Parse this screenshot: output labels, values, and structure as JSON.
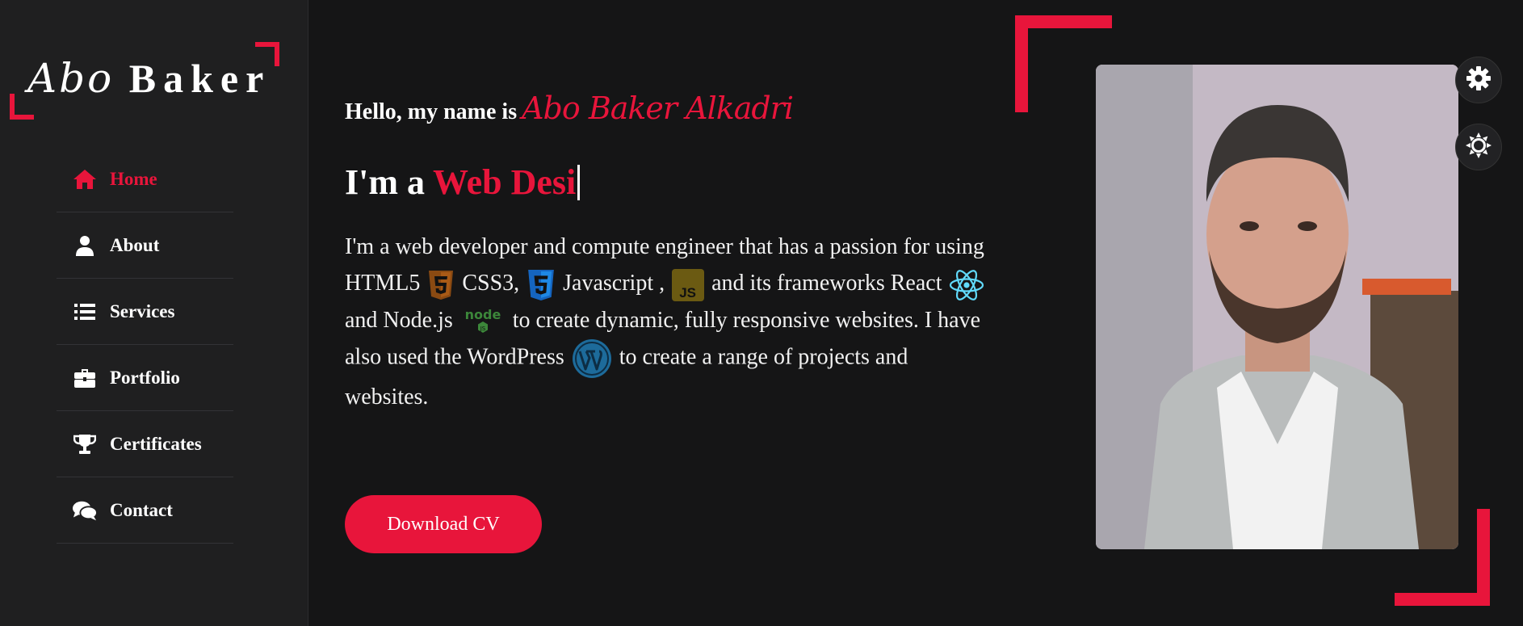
{
  "brand": {
    "script_part": "Abo",
    "bold_part": "Baker",
    "accent_color": "#e8153b"
  },
  "nav": {
    "items": [
      {
        "label": "Home",
        "icon": "home-icon",
        "active": true
      },
      {
        "label": "About",
        "icon": "user-icon",
        "active": false
      },
      {
        "label": "Services",
        "icon": "list-icon",
        "active": false
      },
      {
        "label": "Portfolio",
        "icon": "briefcase-icon",
        "active": false
      },
      {
        "label": "Certificates",
        "icon": "trophy-icon",
        "active": false
      },
      {
        "label": "Contact",
        "icon": "comments-icon",
        "active": false
      }
    ]
  },
  "hero": {
    "greeting": "Hello, my name is",
    "name": "Abo Baker Alkadri",
    "role_prefix": "I'm a",
    "role_typed": "Web Desi",
    "description": {
      "p1": "I'm a web developer and compute engineer that has a passion for using HTML5",
      "p2": "CSS3,",
      "p3": "Javascript ,",
      "p4": "and its frameworks React",
      "p5": "and Node.js",
      "p6": "to create dynamic, fully responsive websites. I have also used the WordPress",
      "p7": "to create a range of projects and websites."
    },
    "tech_icons": [
      "html5-icon",
      "css3-icon",
      "javascript-icon",
      "react-icon",
      "nodejs-icon",
      "wordpress-icon"
    ],
    "cv_button": "Download CV"
  },
  "settings": {
    "icons": [
      "gear-icon",
      "sun-icon"
    ]
  }
}
